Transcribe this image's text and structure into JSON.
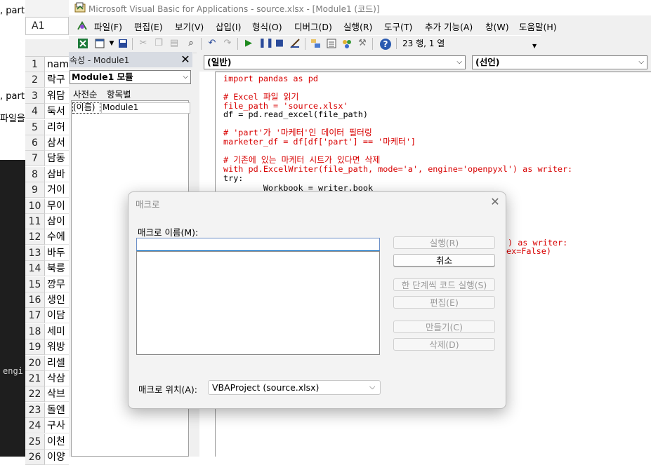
{
  "background": {
    "texts": [
      ", part",
      ", part",
      "파일을"
    ]
  },
  "terminal": {
    "text": "engi"
  },
  "excel": {
    "name_box": "A1",
    "rows": [
      {
        "num": "1",
        "cell": "nam"
      },
      {
        "num": "2",
        "cell": "락구"
      },
      {
        "num": "3",
        "cell": "워담"
      },
      {
        "num": "4",
        "cell": "둑서"
      },
      {
        "num": "5",
        "cell": "리허"
      },
      {
        "num": "6",
        "cell": "삼서"
      },
      {
        "num": "7",
        "cell": "담동"
      },
      {
        "num": "8",
        "cell": "삼바"
      },
      {
        "num": "9",
        "cell": "거이"
      },
      {
        "num": "10",
        "cell": "무이"
      },
      {
        "num": "11",
        "cell": "삼이"
      },
      {
        "num": "12",
        "cell": "수에"
      },
      {
        "num": "13",
        "cell": "바두"
      },
      {
        "num": "14",
        "cell": "북릉"
      },
      {
        "num": "15",
        "cell": "깡무"
      },
      {
        "num": "16",
        "cell": "생인"
      },
      {
        "num": "17",
        "cell": "이담"
      },
      {
        "num": "18",
        "cell": "세미"
      },
      {
        "num": "19",
        "cell": "워방"
      },
      {
        "num": "20",
        "cell": "리셀"
      },
      {
        "num": "21",
        "cell": "삭삼"
      },
      {
        "num": "22",
        "cell": "삭브"
      },
      {
        "num": "23",
        "cell": "돌엔"
      },
      {
        "num": "24",
        "cell": "구사"
      },
      {
        "num": "25",
        "cell": "이천"
      },
      {
        "num": "26",
        "cell": "이양"
      }
    ]
  },
  "vba": {
    "title": "Microsoft Visual Basic for Applications - source.xlsx - [Module1 (코드)]",
    "menu": [
      "파일(F)",
      "편집(E)",
      "보기(V)",
      "삽입(I)",
      "형식(O)",
      "디버그(D)",
      "실행(R)",
      "도구(T)",
      "추가 기능(A)",
      "창(W)",
      "도움말(H)"
    ],
    "position": "23 행, 1 열",
    "properties": {
      "title": "속성 - Module1",
      "object": "Module1 모듈",
      "tabs": [
        "사전순",
        "항목별"
      ],
      "row_key": "(이름)",
      "row_value": "Module1"
    },
    "code": {
      "object_combo": "(일반)",
      "proc_combo": "(선언)",
      "lines": [
        {
          "text": "import pandas as pd",
          "color": "red"
        },
        {
          "text": "",
          "color": "red"
        },
        {
          "text": "# Excel 파일 읽기",
          "color": "red"
        },
        {
          "text": "file_path = 'source.xlsx'",
          "color": "red"
        },
        {
          "text": "df = pd.read_excel(file_path)",
          "color": "black"
        },
        {
          "text": "",
          "color": "black"
        },
        {
          "text": "# 'part'가 '마케터'인 데이터 필터링",
          "color": "red"
        },
        {
          "text": "marketer_df = df[df['part'] == '마케터']",
          "color": "red"
        },
        {
          "text": "",
          "color": "red"
        },
        {
          "text": "# 기존에 있는 마케터 시트가 있다면 삭제",
          "color": "red"
        },
        {
          "text": "with pd.ExcelWriter(file_path, mode='a', engine='openpyxl') as writer:",
          "color": "red"
        },
        {
          "text": "try:",
          "color": "black"
        },
        {
          "text": "        Workbook = writer.book",
          "color": "black"
        }
      ],
      "partial_lines": [
        {
          "text": ") as writer:",
          "color": "red"
        },
        {
          "text": "ex=False)",
          "color": "red"
        }
      ]
    }
  },
  "dialog": {
    "title": "매크로",
    "name_label": "매크로 이름(M):",
    "name_value": "",
    "buttons": {
      "run": "실행(R)",
      "cancel": "취소",
      "step": "한 단계씩 코드 실행(S)",
      "edit": "편집(E)",
      "create": "만들기(C)",
      "delete": "삭제(D)"
    },
    "location_label": "매크로 위치(A):",
    "location_value": "VBAProject (source.xlsx)"
  }
}
